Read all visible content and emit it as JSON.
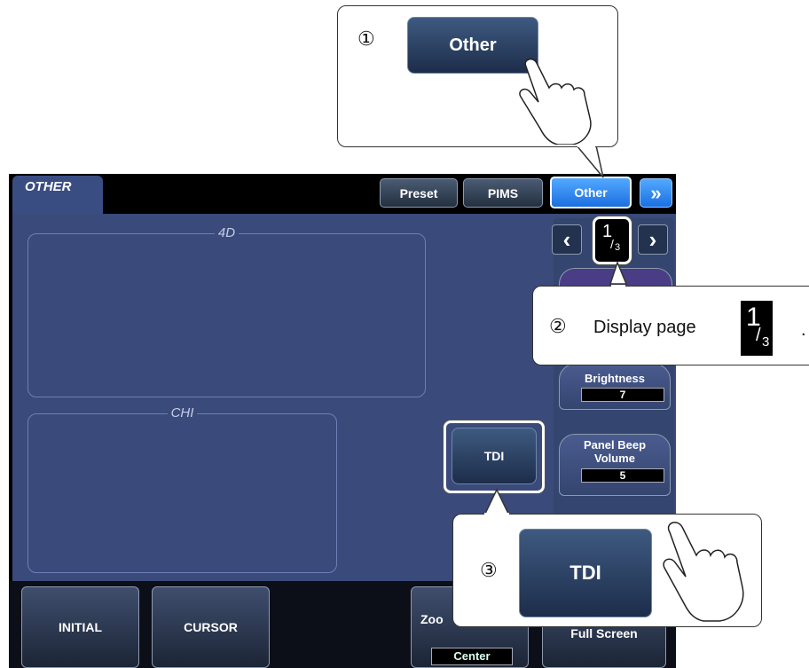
{
  "panel": {
    "tab_label": "OTHER"
  },
  "header": {
    "buttons": [
      {
        "label": "Preset"
      },
      {
        "label": "PIMS"
      },
      {
        "label": "Other"
      }
    ],
    "more_icon": "double-chevron-right"
  },
  "pager": {
    "current": "1",
    "total": "3",
    "separator": "/"
  },
  "groups": {
    "g4d": "4D",
    "chi": "CHI"
  },
  "tdi_button": {
    "label": "TDI"
  },
  "controls": {
    "brightness": {
      "label": "Brightness",
      "value": "7"
    },
    "beep": {
      "label_line1": "Panel Beep",
      "label_line2": "Volume",
      "value": "5"
    }
  },
  "bottom": {
    "initial": "INITIAL",
    "cursor": "CURSOR",
    "zoom_label": "Zoo",
    "zoom_value": "Center",
    "full_screen": "Full Screen"
  },
  "callouts": {
    "step1": {
      "number": "①",
      "button_label": "Other"
    },
    "step2": {
      "number": "②",
      "text": "Display page",
      "end": "."
    },
    "step3": {
      "number": "③",
      "button_label": "TDI"
    }
  }
}
